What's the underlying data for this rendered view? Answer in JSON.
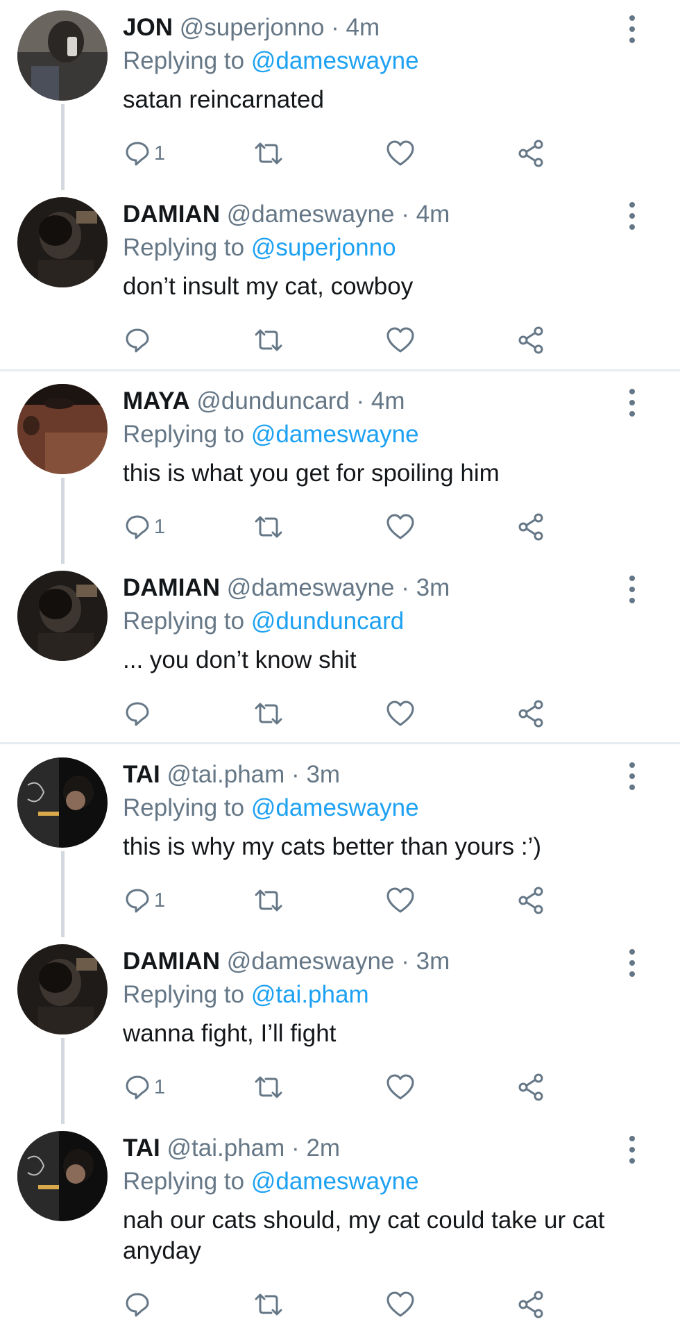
{
  "tweets": [
    {
      "name": "JON",
      "handle": "@superjonno",
      "sep": "·",
      "time": "4m",
      "replying_prefix": "Replying to ",
      "replying_to": "@dameswayne",
      "text": "satan reincarnated",
      "reply_count": "1"
    },
    {
      "name": "DAMIAN",
      "handle": "@dameswayne",
      "sep": "·",
      "time": "4m",
      "replying_prefix": "Replying to ",
      "replying_to": "@superjonno",
      "text": "don’t insult my cat, cowboy",
      "reply_count": ""
    },
    {
      "name": "MAYA",
      "handle": "@dunduncard",
      "sep": "·",
      "time": "4m",
      "replying_prefix": "Replying to ",
      "replying_to": "@dameswayne",
      "text": "this is what you get for spoiling him",
      "reply_count": "1"
    },
    {
      "name": "DAMIAN",
      "handle": "@dameswayne",
      "sep": "·",
      "time": "3m",
      "replying_prefix": "Replying to ",
      "replying_to": "@dunduncard",
      "text": "... you don’t know shit",
      "reply_count": ""
    },
    {
      "name": "TAI",
      "handle": "@tai.pham",
      "sep": "·",
      "time": "3m",
      "replying_prefix": "Replying to ",
      "replying_to": "@dameswayne",
      "text": "this is why my cats better than yours :’)",
      "reply_count": "1"
    },
    {
      "name": "DAMIAN",
      "handle": "@dameswayne",
      "sep": "·",
      "time": "3m",
      "replying_prefix": "Replying to ",
      "replying_to": "@tai.pham",
      "text": "wanna fight, I’ll fight",
      "reply_count": "1"
    },
    {
      "name": "TAI",
      "handle": "@tai.pham",
      "sep": "·",
      "time": "2m",
      "replying_prefix": "Replying to ",
      "replying_to": "@dameswayne",
      "text": "nah our cats should, my cat could take ur cat anyday",
      "reply_count": ""
    }
  ],
  "icons": {
    "reply": "reply-icon",
    "retweet": "retweet-icon",
    "like": "heart-icon",
    "share": "share-icon",
    "more": "more-options-icon"
  },
  "colors": {
    "name": "#14171a",
    "secondary": "#657786",
    "mention": "#1da1f2",
    "thread_line": "#d3d9de",
    "divider": "#e6ecf0"
  }
}
